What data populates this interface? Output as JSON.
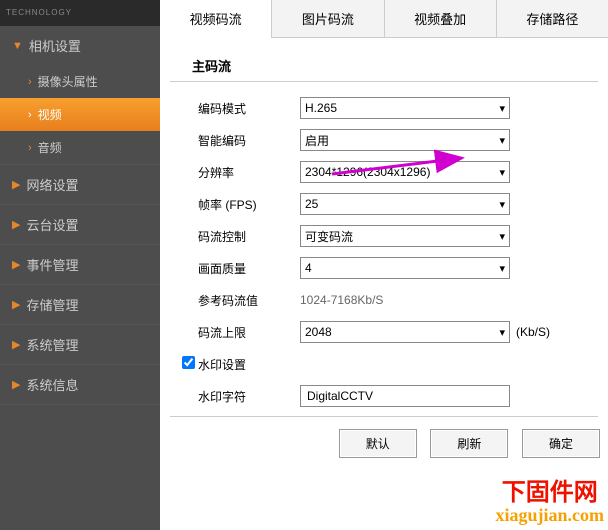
{
  "logo_text": "TECHNOLOGY",
  "sidebar": {
    "cats": [
      {
        "label": "相机设置",
        "open": true,
        "items": [
          {
            "label": "摄像头属性",
            "active": false
          },
          {
            "label": "视频",
            "active": true
          },
          {
            "label": "音频",
            "active": false
          }
        ]
      },
      {
        "label": "网络设置"
      },
      {
        "label": "云台设置"
      },
      {
        "label": "事件管理"
      },
      {
        "label": "存储管理"
      },
      {
        "label": "系统管理"
      },
      {
        "label": "系统信息"
      }
    ]
  },
  "tabs": [
    "视频码流",
    "图片码流",
    "视频叠加",
    "存储路径"
  ],
  "active_tab": 0,
  "section_title": "主码流",
  "form": {
    "encode_mode": {
      "label": "编码模式",
      "value": "H.265"
    },
    "smart_encode": {
      "label": "智能编码",
      "value": "启用"
    },
    "resolution": {
      "label": "分辨率",
      "value": "2304*1296(2304x1296)"
    },
    "fps": {
      "label": "帧率 (FPS)",
      "value": "25"
    },
    "bitrate_ctrl": {
      "label": "码流控制",
      "value": "可变码流"
    },
    "quality": {
      "label": "画面质量",
      "value": "4"
    },
    "ref_bitrate": {
      "label": "参考码流值",
      "value": "1024-7168Kb/S"
    },
    "bitrate_max": {
      "label": "码流上限",
      "value": "2048",
      "unit": "(Kb/S)"
    },
    "watermark_enable": {
      "label": "水印设置",
      "checked": true
    },
    "watermark_text": {
      "label": "水印字符",
      "value": "DigitalCCTV"
    }
  },
  "buttons": {
    "default": "默认",
    "refresh": "刷新",
    "ok": "确定"
  },
  "watermark_site": {
    "line1": "下固件网",
    "line2": "xiagujian.com"
  }
}
